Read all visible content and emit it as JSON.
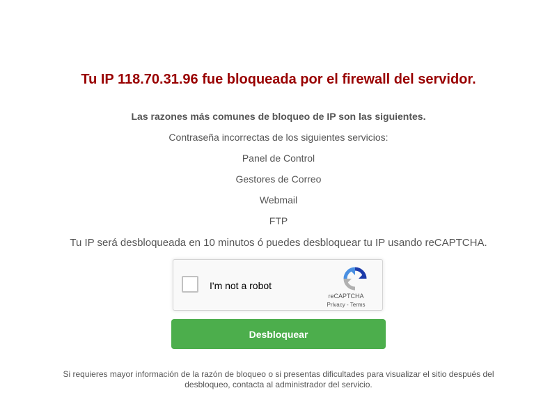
{
  "block_notice": {
    "title": "Tu IP 118.70.31.96 fue bloqueada por el firewall del servidor.",
    "reasons_heading": "Las razones más comunes de bloqueo de IP son las siguientes.",
    "reasons_intro": "Contraseña incorrectas de los siguientes servicios:",
    "services": [
      "Panel de Control",
      "Gestores de Correo",
      "Webmail",
      "FTP"
    ],
    "unblock_info": "Tu IP será desbloqueada en 10 minutos ó puedes desbloquear tu IP usando reCAPTCHA."
  },
  "recaptcha": {
    "checkbox_label": "I'm not a robot",
    "brand": "reCAPTCHA",
    "privacy_link": "Privacy",
    "separator": " - ",
    "terms_link": "Terms",
    "logo_icon": "recaptcha-logo-icon",
    "colors": {
      "blue": "#1c3aa9",
      "light_blue": "#4a90e2",
      "gray": "#b1b1b1"
    }
  },
  "actions": {
    "unblock_label": "Desbloquear",
    "button_color": "#4cae4c"
  },
  "footer": {
    "note": "Si requieres mayor información de la razón de bloqueo o si presentas dificultades para visualizar el sitio después del desbloqueo, contacta al administrador del servicio."
  },
  "colors": {
    "title": "#990000",
    "text": "#555555"
  }
}
